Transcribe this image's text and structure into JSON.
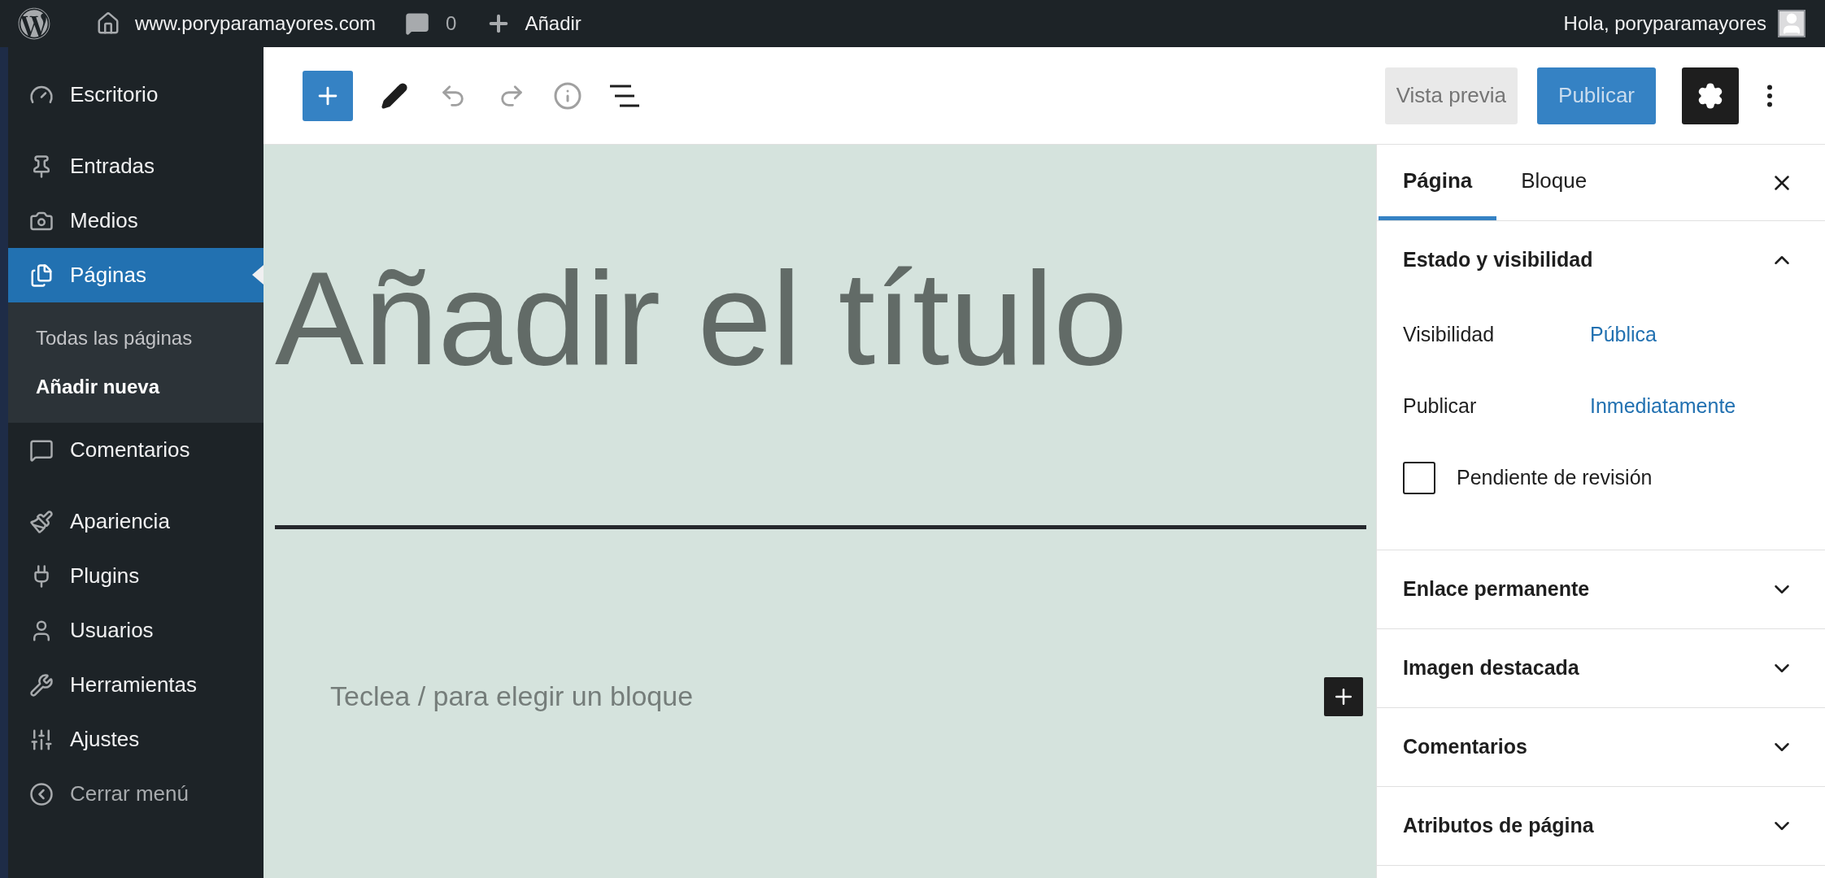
{
  "admin_bar": {
    "site": "www.poryparamayores.com",
    "comments_count": "0",
    "new_label": "Añadir",
    "greeting": "Hola, poryparamayores"
  },
  "sidebar": {
    "groups": [
      [
        {
          "kind": "dashboard",
          "label": "Escritorio",
          "selected": false
        }
      ],
      [
        {
          "kind": "posts",
          "label": "Entradas",
          "selected": false
        },
        {
          "kind": "media",
          "label": "Medios",
          "selected": false
        },
        {
          "kind": "pages",
          "label": "Páginas",
          "selected": true,
          "children": [
            {
              "label": "Todas las páginas",
              "selected": false
            },
            {
              "label": "Añadir nueva",
              "selected": true
            }
          ]
        },
        {
          "kind": "comments",
          "label": "Comentarios",
          "selected": false
        }
      ],
      [
        {
          "kind": "appearance",
          "label": "Apariencia",
          "selected": false
        },
        {
          "kind": "plugins",
          "label": "Plugins",
          "selected": false
        },
        {
          "kind": "users",
          "label": "Usuarios",
          "selected": false
        },
        {
          "kind": "tools",
          "label": "Herramientas",
          "selected": false
        },
        {
          "kind": "settings",
          "label": "Ajustes",
          "selected": false
        },
        {
          "kind": "collapse",
          "label": "Cerrar menú",
          "selected": false
        }
      ]
    ]
  },
  "toolbar": {
    "preview": "Vista previa",
    "publish": "Publicar",
    "settings_on": true
  },
  "editor": {
    "title_placeholder": "Añadir el título",
    "block_placeholder": "Teclea / para elegir un bloque"
  },
  "panel": {
    "tabs": [
      {
        "label": "Página",
        "selected": true
      },
      {
        "label": "Bloque",
        "selected": false
      }
    ],
    "sections": [
      {
        "title": "Estado y visibilidad",
        "expanded": true,
        "rows": [
          {
            "label": "Visibilidad",
            "value": "Pública"
          },
          {
            "label": "Publicar",
            "value": "Inmediatamente"
          }
        ],
        "checkbox": {
          "label": "Pendiente de revisión",
          "checked": false
        }
      },
      {
        "title": "Enlace permanente",
        "expanded": false
      },
      {
        "title": "Imagen destacada",
        "expanded": false
      },
      {
        "title": "Comentarios",
        "expanded": false
      },
      {
        "title": "Atributos de página",
        "expanded": false
      }
    ]
  }
}
